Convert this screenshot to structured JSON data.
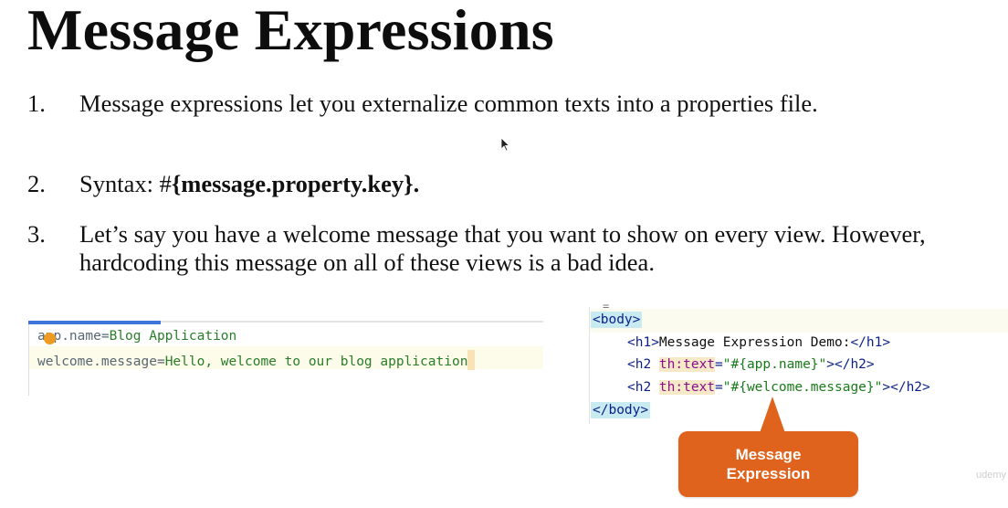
{
  "slide": {
    "title": "Message Expressions",
    "items": [
      {
        "num": "1.",
        "text": "Message expressions let you externalize common texts into a properties file."
      },
      {
        "num": "2.",
        "text_prefix": "Syntax: #",
        "text_bold": "{message.property.key}."
      },
      {
        "num": "3.",
        "text": "Let’s say you have a welcome message that you want to show on every view. However, hardcoding this message on all of these views is a bad idea."
      }
    ]
  },
  "properties_file": {
    "lines": [
      {
        "key": "app.name",
        "sep": "=",
        "value": "Blog Application"
      },
      {
        "key": "welcome.message",
        "sep": "=",
        "value": "Hello, welcome to our blog application"
      }
    ]
  },
  "html_code": {
    "marker": "=",
    "body_open": "<body>",
    "h1_open": "<h1>",
    "h1_text": "Message Expression Demo:",
    "h1_close": "</h1>",
    "h2_open": "<h2 ",
    "attr": "th:text",
    "attr_eq": "=",
    "h2_value_1": "\"#{app.name}\"",
    "h2_value_2": "\"#{welcome.message}\"",
    "h2_close": "></h2>",
    "body_close": "</body>"
  },
  "callout": {
    "label": "Message Expression",
    "color": "#e0631d"
  },
  "watermark": "udemy"
}
